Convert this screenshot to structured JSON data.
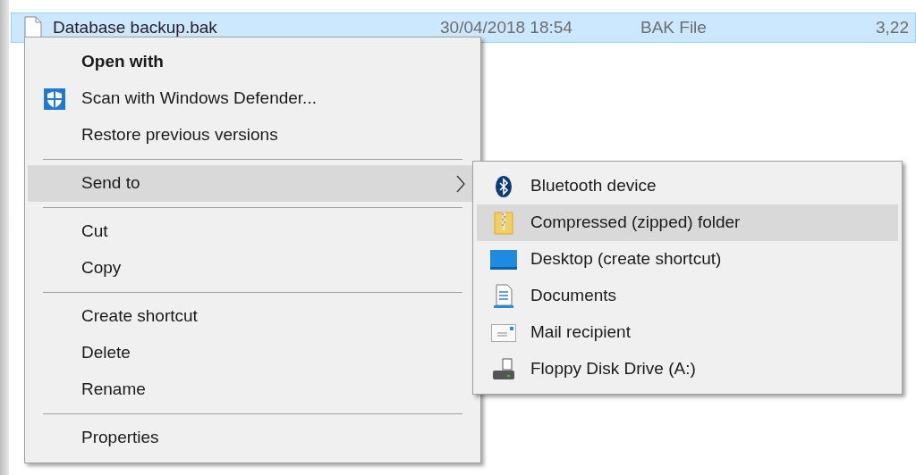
{
  "file_row": {
    "name": "Database backup.bak",
    "date_modified": "30/04/2018 18:54",
    "type": "BAK File",
    "size": "3,22",
    "selected": true
  },
  "context_menu": {
    "items": [
      {
        "kind": "item",
        "label": "Open with",
        "bold": true,
        "highlighted": false,
        "submenu": false
      },
      {
        "kind": "item",
        "label": "Scan with Windows Defender...",
        "bold": false,
        "highlighted": false,
        "submenu": false
      },
      {
        "kind": "item",
        "label": "Restore previous versions",
        "bold": false,
        "highlighted": false,
        "submenu": false
      },
      {
        "kind": "separator"
      },
      {
        "kind": "item",
        "label": "Send to",
        "bold": false,
        "highlighted": true,
        "submenu": true
      },
      {
        "kind": "separator"
      },
      {
        "kind": "item",
        "label": "Cut",
        "bold": false,
        "highlighted": false,
        "submenu": false
      },
      {
        "kind": "item",
        "label": "Copy",
        "bold": false,
        "highlighted": false,
        "submenu": false
      },
      {
        "kind": "separator"
      },
      {
        "kind": "item",
        "label": "Create shortcut",
        "bold": false,
        "highlighted": false,
        "submenu": false
      },
      {
        "kind": "item",
        "label": "Delete",
        "bold": false,
        "highlighted": false,
        "submenu": false
      },
      {
        "kind": "item",
        "label": "Rename",
        "bold": false,
        "highlighted": false,
        "submenu": false
      },
      {
        "kind": "separator"
      },
      {
        "kind": "item",
        "label": "Properties",
        "bold": false,
        "highlighted": false,
        "submenu": false
      }
    ]
  },
  "send_to_menu": {
    "items": [
      {
        "label": "Bluetooth device",
        "highlighted": false
      },
      {
        "label": "Compressed (zipped) folder",
        "highlighted": true
      },
      {
        "label": "Desktop (create shortcut)",
        "highlighted": false
      },
      {
        "label": "Documents",
        "highlighted": false
      },
      {
        "label": "Mail recipient",
        "highlighted": false
      },
      {
        "label": "Floppy Disk Drive (A:)",
        "highlighted": false
      }
    ]
  }
}
